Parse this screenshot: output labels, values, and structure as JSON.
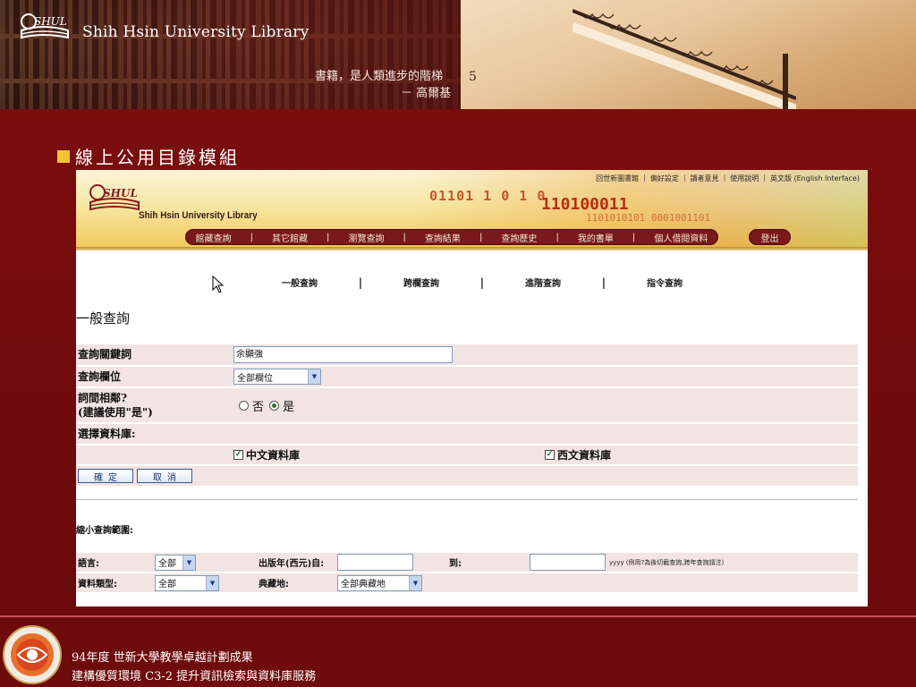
{
  "banner": {
    "library_name": "Shih Hsin University Library",
    "quote_line1": "書籍，是人類進步的階梯",
    "quote_line2": "－ 高爾基",
    "sign": "5"
  },
  "slide": {
    "title": "線上公用目錄模組"
  },
  "opac": {
    "library_name": "Shih Hsin University Library",
    "logo_text": "SHUL",
    "util_links": [
      "回世新圖書館",
      "偏好設定",
      "讀者意見",
      "使用說明",
      "英文版 (English Interface)"
    ],
    "nav_items": [
      "館藏查詢",
      "其它館藏",
      "瀏覽查詢",
      "查詢結果",
      "查詢歷史",
      "我的書單",
      "個人借閱資料"
    ],
    "logout_label": "登出",
    "header_bits": "01101 1 0 1 0",
    "header_bits2": "110100011",
    "header_bits3": "1101010101 0001001101"
  },
  "tabs": [
    {
      "label": "一般查詢"
    },
    {
      "label": "跨欄查詢"
    },
    {
      "label": "進階查詢"
    },
    {
      "label": "指令查詢"
    }
  ],
  "tab_separator": "|",
  "search": {
    "section_title": "一般查詢",
    "keyword_label": "查詢關鍵詞",
    "keyword_value": "余顯強",
    "field_label": "查詢欄位",
    "field_value": "全部欄位",
    "adjacent_label_1": "詞間相鄰?",
    "adjacent_label_2": "(建議使用\"是\")",
    "radio_no": "否",
    "radio_yes": "是",
    "adjacent_selected": "是",
    "database_label": "選擇資料庫:",
    "db_chinese": "中文資料庫",
    "db_western": "西文資料庫",
    "db_chinese_checked": true,
    "db_western_checked": true,
    "submit_label": "確定",
    "cancel_label": "取消"
  },
  "narrow": {
    "title": "縮小查詢範圍:",
    "language_label": "語言:",
    "language_value": "全部",
    "year_from_label": "出版年(西元)自:",
    "year_to_label": "到:",
    "year_hint": "yyyy (例用?為後切截查詢,跨年查詢請注)",
    "type_label": "資料類型:",
    "type_value": "全部",
    "location_label": "典藏地:",
    "location_value": "全部典藏地"
  },
  "footer": {
    "line1": "94年度 世新大學教學卓越計劃成果",
    "line2": "建構優質環境 C3-2 提升資訊檢索與資料庫服務"
  },
  "colors": {
    "slide_background": "#6e0b0b",
    "title_bullet": "#f4c430",
    "nav_bar": "#7a1919",
    "form_row": "#f3e4e4"
  }
}
